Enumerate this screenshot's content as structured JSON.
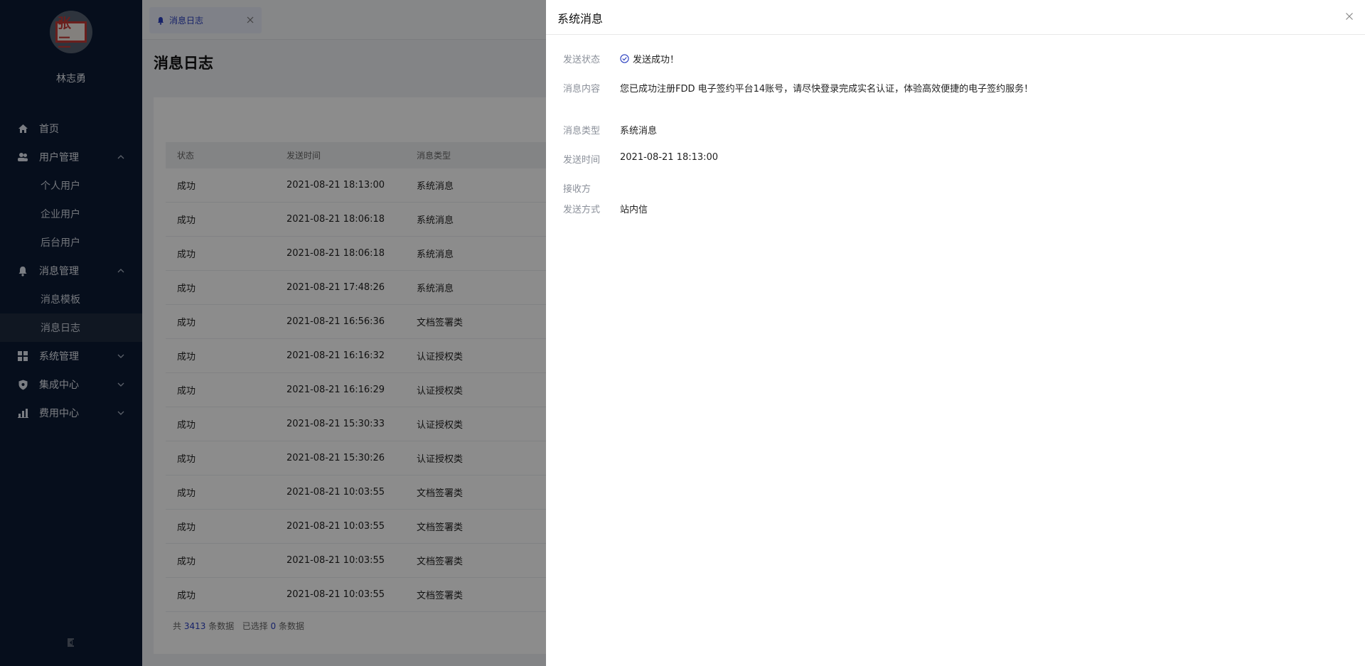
{
  "sidebar": {
    "avatar_text": "张三",
    "user_name": "林志勇",
    "menu": {
      "home": "首页",
      "user_mgmt": "用户管理",
      "user_subs": [
        "个人用户",
        "企业用户",
        "后台用户"
      ],
      "msg_mgmt": "消息管理",
      "msg_subs": [
        "消息模板",
        "消息日志"
      ],
      "sys_mgmt": "系统管理",
      "integration": "集成中心",
      "billing": "费用中心"
    }
  },
  "tabbar": {
    "tab_label": "消息日志"
  },
  "page": {
    "title": "消息日志"
  },
  "table": {
    "columns": [
      "状态",
      "发送时间",
      "消息类型"
    ],
    "rows": [
      [
        "成功",
        "2021-08-21 18:13:00",
        "系统消息"
      ],
      [
        "成功",
        "2021-08-21 18:06:18",
        "系统消息"
      ],
      [
        "成功",
        "2021-08-21 18:06:18",
        "系统消息"
      ],
      [
        "成功",
        "2021-08-21 17:48:26",
        "系统消息"
      ],
      [
        "成功",
        "2021-08-21 16:56:36",
        "文档签署类"
      ],
      [
        "成功",
        "2021-08-21 16:16:32",
        "认证授权类"
      ],
      [
        "成功",
        "2021-08-21 16:16:29",
        "认证授权类"
      ],
      [
        "成功",
        "2021-08-21 15:30:33",
        "认证授权类"
      ],
      [
        "成功",
        "2021-08-21 15:30:26",
        "认证授权类"
      ],
      [
        "成功",
        "2021-08-21 10:03:55",
        "文档签署类"
      ],
      [
        "成功",
        "2021-08-21 10:03:55",
        "文档签署类"
      ],
      [
        "成功",
        "2021-08-21 10:03:55",
        "文档签署类"
      ],
      [
        "成功",
        "2021-08-21 10:03:55",
        "文档签署类"
      ]
    ],
    "footer": {
      "prefix": "共",
      "total": "3413",
      "mid": "条数据",
      "selected_prefix": "已选择",
      "selected": "0",
      "suffix": "条数据"
    }
  },
  "drawer": {
    "title": "系统消息",
    "fields": {
      "status_label": "发送状态",
      "status_value": "发送成功！",
      "content_label": "消息内容",
      "content_value": "您已成功注册FDD 电子签约平台14账号，请尽快登录完成实名认证，体验高效便捷的电子签约服务！",
      "type_label": "消息类型",
      "type_value": "系统消息",
      "time_label": "发送时间",
      "time_value": "2021-08-21 18:13:00",
      "receiver_label": "接收方",
      "receiver_value": "",
      "method_label": "发送方式",
      "method_value": "站内信"
    }
  },
  "colors": {
    "accent": "#2a3fbf",
    "sidebar_bg": "#0b1a33",
    "overlay": "rgba(0,0,0,0.45)"
  }
}
